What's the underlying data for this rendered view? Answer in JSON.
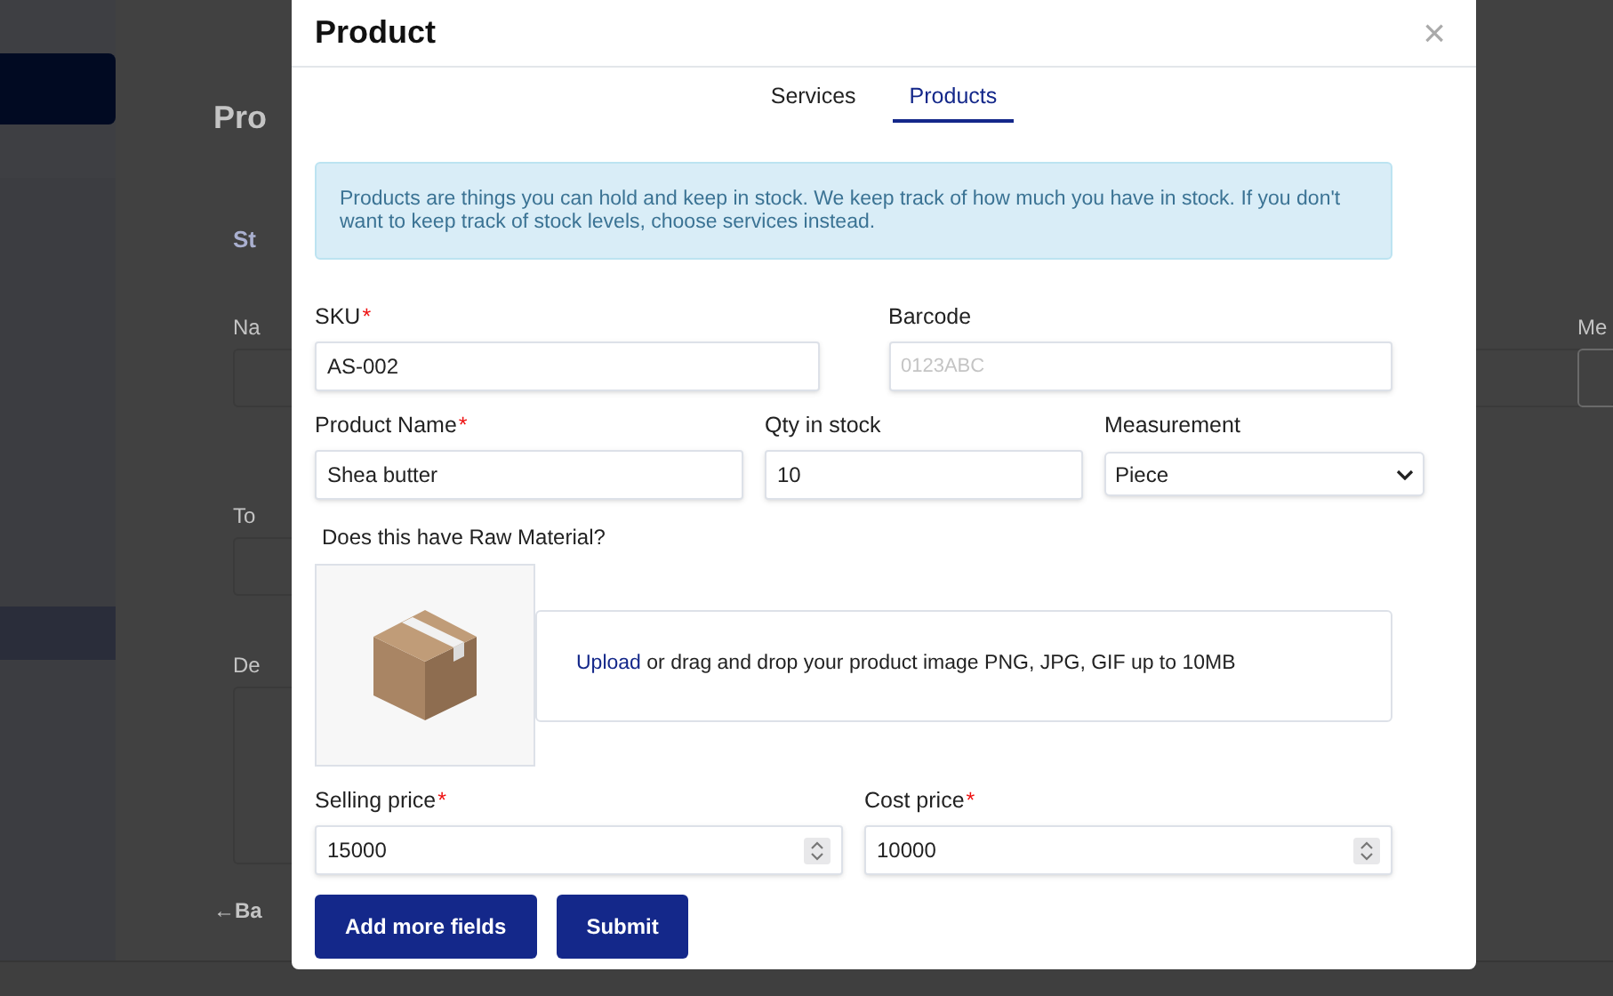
{
  "background": {
    "heading": "Pro",
    "section": "St",
    "labels": [
      "Na",
      "To",
      "De"
    ],
    "back_link": {
      "arrow": "←",
      "text": "Ba"
    },
    "right_label": "Me"
  },
  "modal": {
    "title": "Product",
    "close": "×",
    "tabs": [
      {
        "label": "Services",
        "selected": false
      },
      {
        "label": "Products",
        "selected": true
      }
    ],
    "notice": "Products are things you can hold and keep in stock. We keep track of how much you have in stock. If you don't want to keep track of stock levels, choose services instead.",
    "rows": [
      [
        {
          "label": "SKU",
          "required_mark": "*",
          "kind": "text",
          "value": "AS-002"
        },
        {
          "label": "Barcode",
          "kind": "text",
          "placeholder": "0123ABC"
        }
      ],
      [
        {
          "label": "Product Name",
          "required_mark": "*",
          "kind": "text",
          "value": "Shea butter"
        },
        {
          "label": "Qty in stock",
          "kind": "text",
          "value": "10"
        },
        {
          "label": "Measurement",
          "kind": "select",
          "value": "Piece"
        }
      ]
    ],
    "raw_material_question": "Does this have Raw Material?",
    "upload": {
      "link": "Upload",
      "text": "or drag and drop your product image PNG, JPG, GIF up to 10MB"
    },
    "prices": [
      {
        "label": "Selling price",
        "required_mark": "*",
        "kind": "number",
        "value": "15000"
      },
      {
        "label": "Cost price",
        "required_mark": "*",
        "kind": "number",
        "value": "10000"
      }
    ],
    "buttons": [
      "Add more fields",
      "Submit"
    ]
  }
}
